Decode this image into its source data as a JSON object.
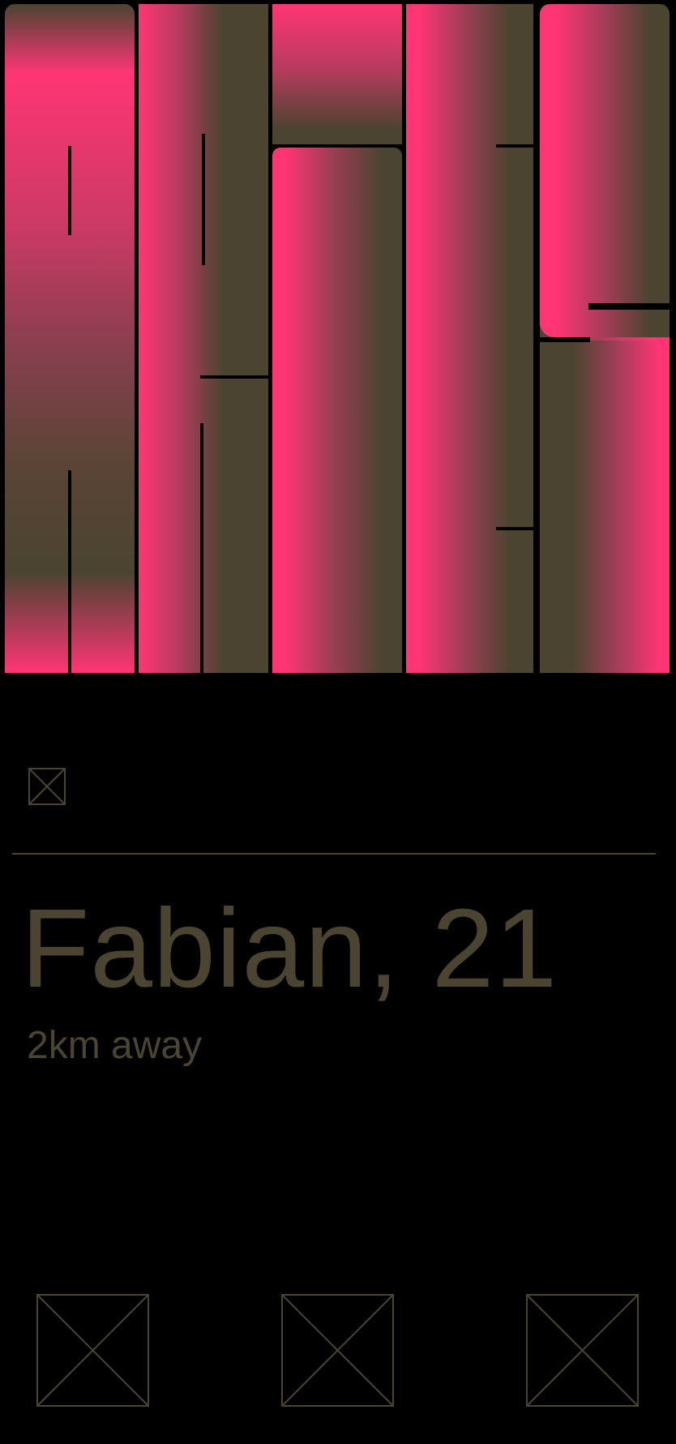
{
  "profile": {
    "name_age": "Fabian, 21",
    "distance": "2km away"
  },
  "icons": {
    "top": "image-placeholder-icon",
    "actions": [
      "image-placeholder-icon",
      "image-placeholder-icon",
      "image-placeholder-icon"
    ]
  },
  "colors": {
    "background": "#000000",
    "accent_pink": "#ff3575",
    "olive": "#4a4430"
  }
}
